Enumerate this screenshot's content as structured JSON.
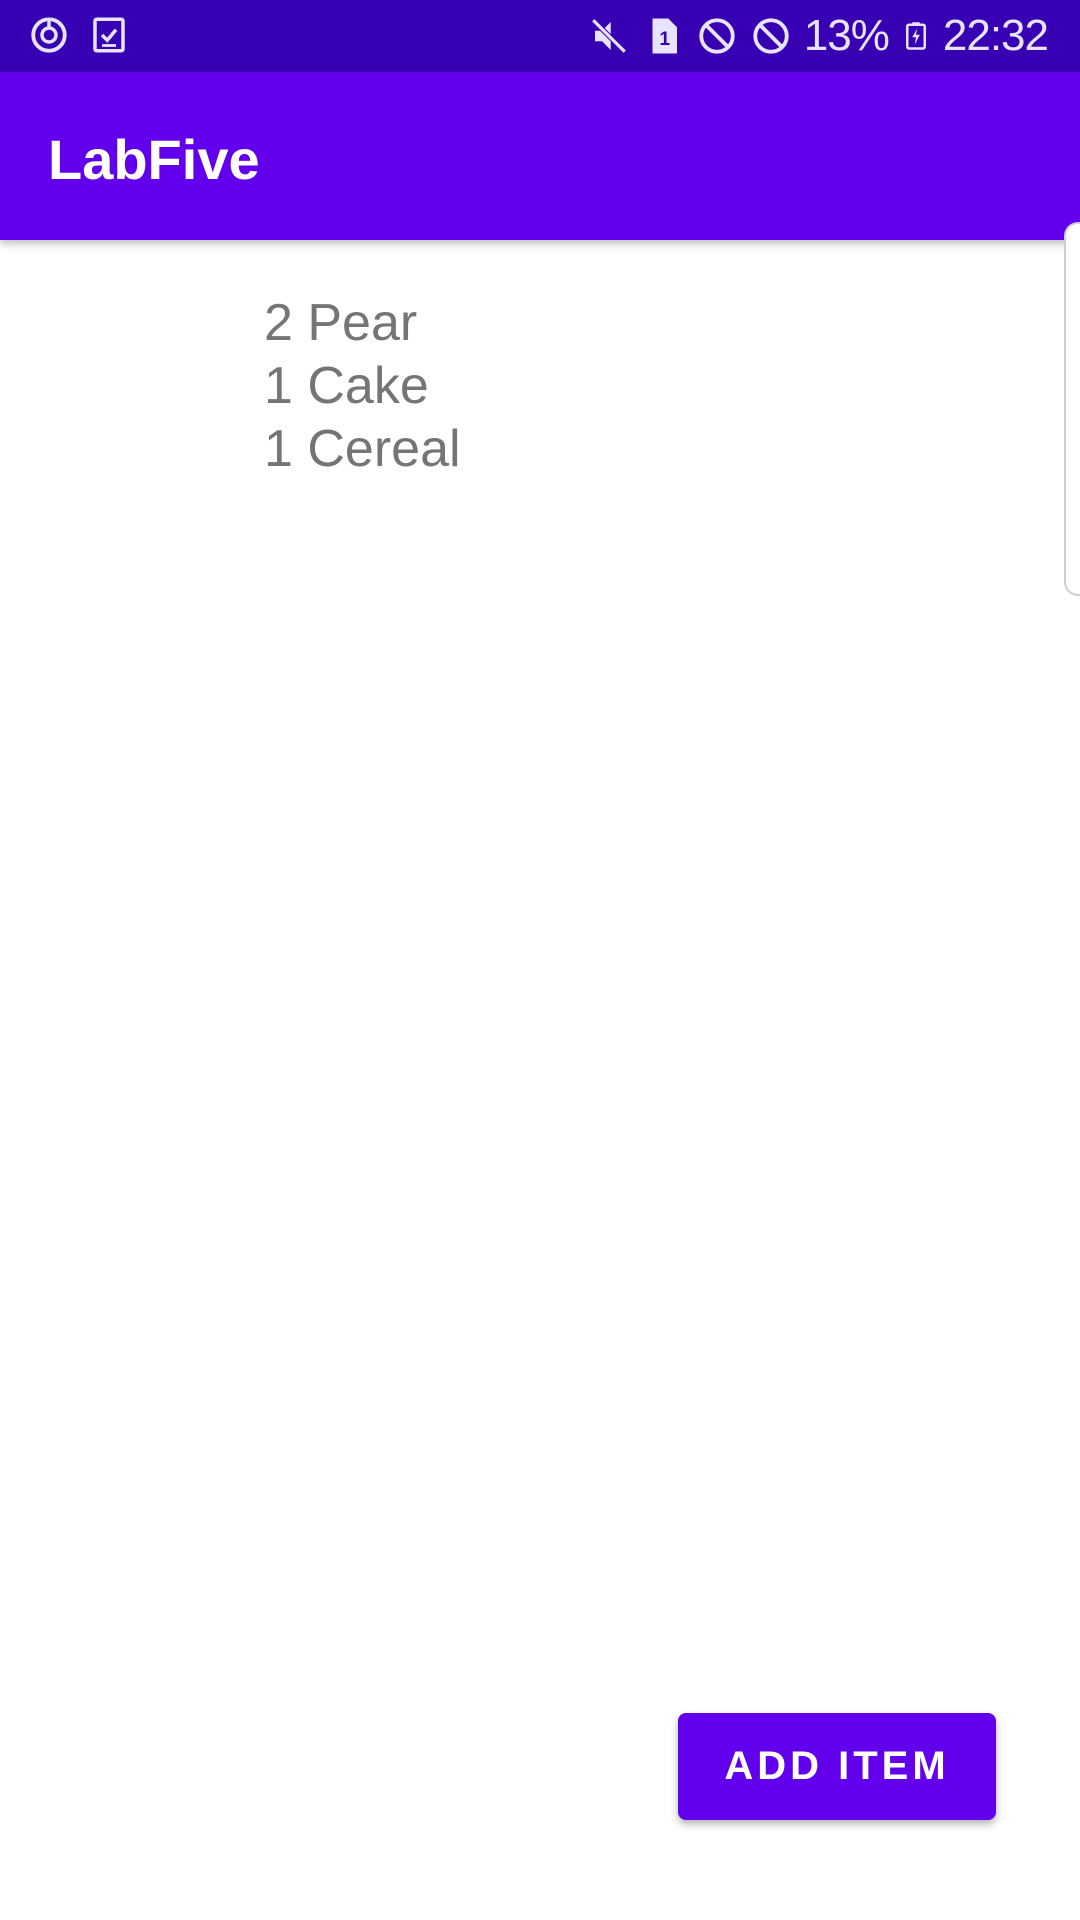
{
  "status_bar": {
    "left_icons": [
      "sync-icon",
      "task-check-icon"
    ],
    "right_icons": [
      "mute-icon",
      "sim-1-icon",
      "block-icon",
      "block-icon",
      "battery-charging-icon"
    ],
    "sim_label": "1",
    "battery": "13%",
    "time": "22:32",
    "background_color": "#3700b3"
  },
  "app_bar": {
    "title": "LabFive",
    "background_color": "#6200ee"
  },
  "items": [
    {
      "label": "2 Pear"
    },
    {
      "label": "1 Cake"
    },
    {
      "label": "1 Cereal"
    }
  ],
  "add_button": {
    "label": "ADD ITEM",
    "background_color": "#6200ee"
  }
}
